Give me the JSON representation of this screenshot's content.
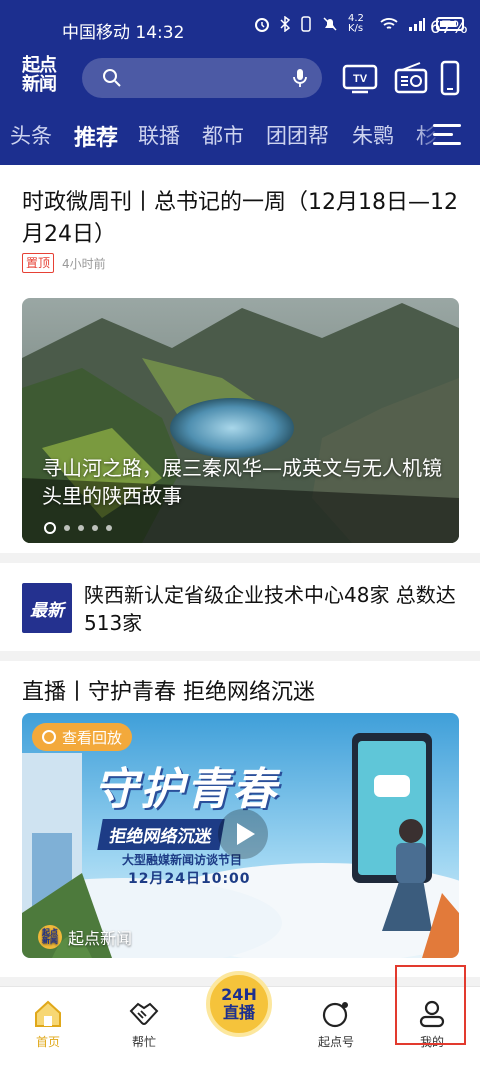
{
  "status_bar": {
    "carrier_time": "中国移动 14:32",
    "net_speed": "4.2 K/s",
    "battery": "67%"
  },
  "header": {
    "logo": [
      "起点",
      "新闻"
    ],
    "icons": [
      "search-icon",
      "mic-icon",
      "tv-icon",
      "radio-icon",
      "phone-icon"
    ]
  },
  "channels": {
    "tabs": [
      "头条",
      "推荐",
      "联播",
      "都市",
      "团团帮",
      "朱鹮",
      "杉"
    ],
    "active": "推荐"
  },
  "feed": {
    "top_article": {
      "title": "时政微周刊丨总书记的一周（12月18日—12月24日）",
      "tag": "置顶",
      "time": "4小时前"
    },
    "carousel": {
      "caption": "寻山河之路，展三秦风华—成英文与无人机镜头里的陕西故事",
      "slide_count": 5,
      "active_slide": 1
    },
    "latest": {
      "badge": "最新",
      "title": "陕西新认定省级企业技术中心48家  总数达513家"
    },
    "live_article": {
      "title": "直播丨守护青春  拒绝网络沉迷",
      "replay_label": "查看回放",
      "poster_title": "守护青春",
      "poster_subtitle": "拒绝网络沉迷",
      "poster_program": "大型融媒新闻访谈节目",
      "poster_time": "12月24日10:00",
      "source": "起点新闻"
    }
  },
  "bottom_nav": {
    "items": [
      "首页",
      "帮忙",
      "起点号",
      "我的"
    ],
    "live_button": [
      "24H",
      "直播"
    ],
    "active": "首页"
  },
  "colors": {
    "header_bg": "#1c2f8f",
    "accent_gold": "#e0a81a",
    "tag_red": "#e64135"
  }
}
